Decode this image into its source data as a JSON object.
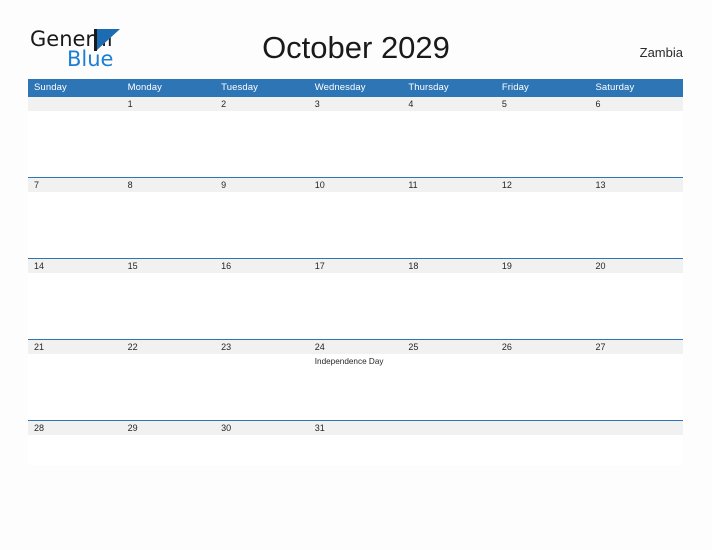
{
  "brand": {
    "name_part1": "General",
    "name_part2": "Blue",
    "flag_icon": "flag-triangle-icon"
  },
  "header": {
    "title": "October 2029",
    "country": "Zambia"
  },
  "calendar": {
    "weekdays": [
      "Sunday",
      "Monday",
      "Tuesday",
      "Wednesday",
      "Thursday",
      "Friday",
      "Saturday"
    ],
    "accent_color": "#2e75b6",
    "band_color": "#f1f1f1",
    "weeks": [
      {
        "days": [
          {
            "num": "",
            "event": ""
          },
          {
            "num": "1",
            "event": ""
          },
          {
            "num": "2",
            "event": ""
          },
          {
            "num": "3",
            "event": ""
          },
          {
            "num": "4",
            "event": ""
          },
          {
            "num": "5",
            "event": ""
          },
          {
            "num": "6",
            "event": ""
          }
        ]
      },
      {
        "days": [
          {
            "num": "7",
            "event": ""
          },
          {
            "num": "8",
            "event": ""
          },
          {
            "num": "9",
            "event": ""
          },
          {
            "num": "10",
            "event": ""
          },
          {
            "num": "11",
            "event": ""
          },
          {
            "num": "12",
            "event": ""
          },
          {
            "num": "13",
            "event": ""
          }
        ]
      },
      {
        "days": [
          {
            "num": "14",
            "event": ""
          },
          {
            "num": "15",
            "event": ""
          },
          {
            "num": "16",
            "event": ""
          },
          {
            "num": "17",
            "event": ""
          },
          {
            "num": "18",
            "event": ""
          },
          {
            "num": "19",
            "event": ""
          },
          {
            "num": "20",
            "event": ""
          }
        ]
      },
      {
        "days": [
          {
            "num": "21",
            "event": ""
          },
          {
            "num": "22",
            "event": ""
          },
          {
            "num": "23",
            "event": ""
          },
          {
            "num": "24",
            "event": "Independence Day"
          },
          {
            "num": "25",
            "event": ""
          },
          {
            "num": "26",
            "event": ""
          },
          {
            "num": "27",
            "event": ""
          }
        ]
      },
      {
        "days": [
          {
            "num": "28",
            "event": ""
          },
          {
            "num": "29",
            "event": ""
          },
          {
            "num": "30",
            "event": ""
          },
          {
            "num": "31",
            "event": ""
          },
          {
            "num": "",
            "event": ""
          },
          {
            "num": "",
            "event": ""
          },
          {
            "num": "",
            "event": ""
          }
        ]
      }
    ]
  }
}
